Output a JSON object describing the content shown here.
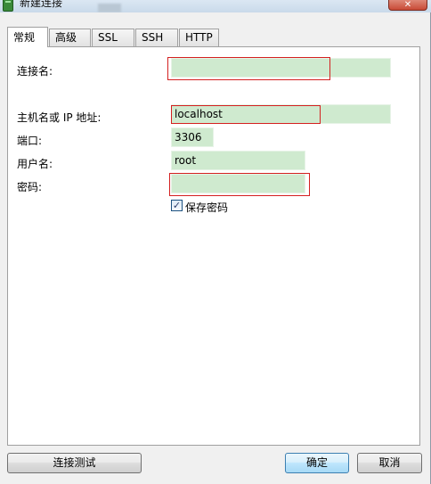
{
  "window": {
    "title": "新建连接"
  },
  "tabs": [
    {
      "label": "常规"
    },
    {
      "label": "高级"
    },
    {
      "label": "SSL"
    },
    {
      "label": "SSH"
    },
    {
      "label": "HTTP"
    }
  ],
  "form": {
    "connection_name_label": "连接名:",
    "connection_name_value": "",
    "host_label": "主机名或 IP 地址:",
    "host_value": "localhost",
    "port_label": "端口:",
    "port_value": "3306",
    "username_label": "用户名:",
    "username_value": "root",
    "password_label": "密码:",
    "password_value": "",
    "save_password_label": "保存密码",
    "save_password_checked": true
  },
  "buttons": {
    "test_connection": "连接测试",
    "ok": "确定",
    "cancel": "取消"
  },
  "colors": {
    "field_background": "#cfeacf",
    "highlight_box": "#d42020"
  }
}
